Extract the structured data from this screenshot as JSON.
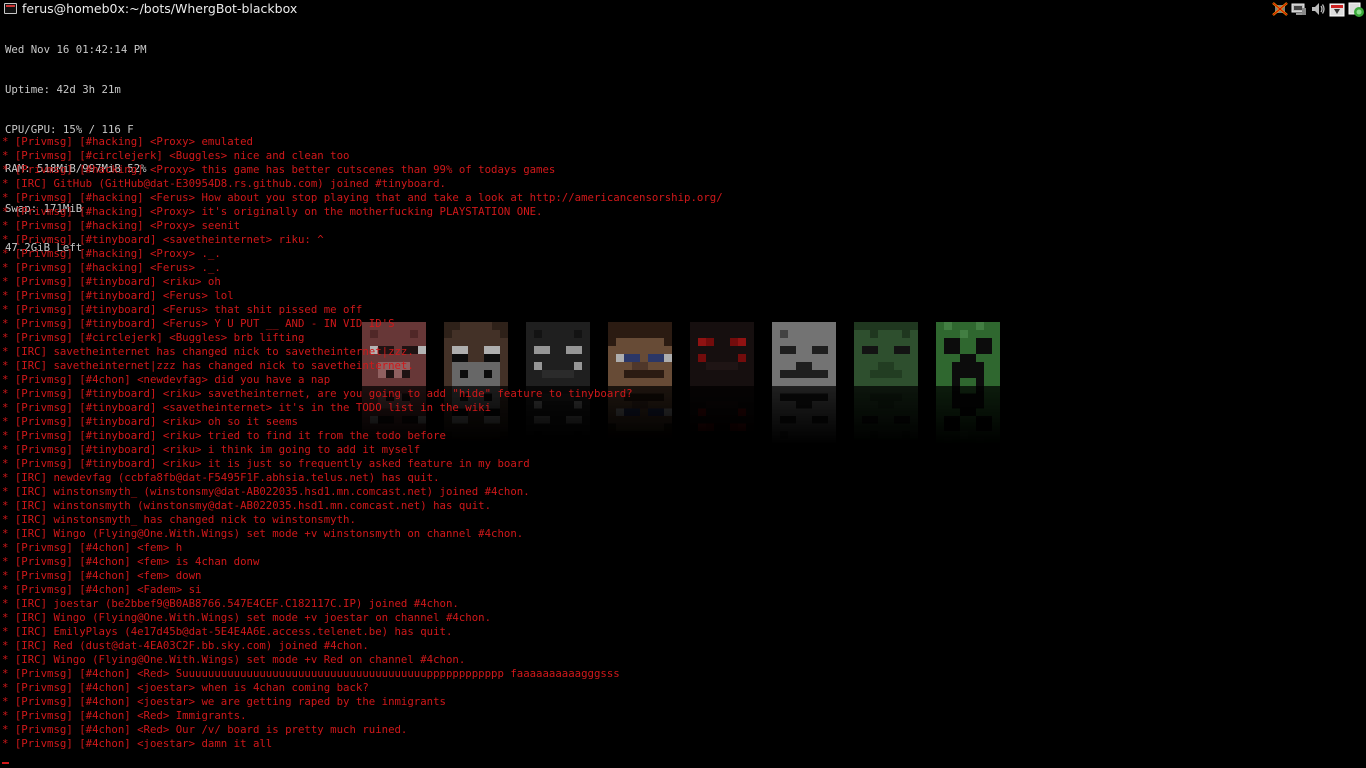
{
  "window": {
    "title": "ferus@homeb0x:~/bots/WhergBot-blackbox"
  },
  "tray": {
    "icons": [
      "network-disconnected-icon",
      "display-settings-icon",
      "volume-icon",
      "download-icon",
      "update-notifier-icon"
    ]
  },
  "sysinfo": {
    "datetime": "Wed Nov 16 01:42:14 PM",
    "uptime": "Uptime: 42d 3h 21m",
    "cpu_gpu": "CPU/GPU: 15% / 116 F",
    "ram": "RAM: 518MiB/997MiB 52%",
    "swap": "Swap: 171MiB",
    "disk": "47.2GiB Left"
  },
  "wallpaper": {
    "mobs": [
      "pig-face",
      "cow-face",
      "spider-face",
      "steve-face",
      "cave-spider-face",
      "skeleton-face",
      "zombie-face",
      "creeper-face"
    ]
  },
  "log": [
    "* [Privmsg] [#hacking] <Proxy> emulated",
    "* [Privmsg] [#circlejerk] <Buggles> nice and clean too",
    "* [Privmsg] [#hacking] <Proxy> this game has better cutscenes than 99% of todays games",
    "* [IRC] GitHub (GitHub@dat-E30954D8.rs.github.com) joined #tinyboard.",
    "* [Privmsg] [#hacking] <Ferus> How about you stop playing that and take a look at http://americancensorship.org/",
    "* [Privmsg] [#hacking] <Proxy> it's originally on the motherfucking PLAYSTATION ONE.",
    "* [Privmsg] [#hacking] <Proxy> seenit",
    "* [Privmsg] [#tinyboard] <savetheinternet> riku: ^",
    "* [Privmsg] [#hacking] <Proxy> ._.",
    "* [Privmsg] [#hacking] <Ferus> ._.",
    "* [Privmsg] [#tinyboard] <riku> oh",
    "* [Privmsg] [#tinyboard] <Ferus> lol",
    "* [Privmsg] [#tinyboard] <Ferus> that shit pissed me off",
    "* [Privmsg] [#tinyboard] <Ferus> Y U PUT __ AND - IN VID ID'S",
    "* [Privmsg] [#circlejerk] <Buggles> brb lifting",
    "* [IRC] savetheinternet has changed nick to savetheinternet|zzz.",
    "* [IRC] savetheinternet|zzz has changed nick to savetheinternet.",
    "* [Privmsg] [#4chon] <newdevfag> did you have a nap",
    "* [Privmsg] [#tinyboard] <riku> savetheinternet, are you going to add \"hide\" feature to tinyboard?",
    "* [Privmsg] [#tinyboard] <savetheinternet> it's in the TODO list in the wiki",
    "* [Privmsg] [#tinyboard] <riku> oh so it seems",
    "* [Privmsg] [#tinyboard] <riku> tried to find it from the todo before",
    "* [Privmsg] [#tinyboard] <riku> i think im going to add it myself",
    "* [Privmsg] [#tinyboard] <riku> it is just so frequently asked feature in my board",
    "* [IRC] newdevfag (ccbfa8fb@dat-F5495F1F.abhsia.telus.net) has quit.",
    "* [IRC] winstonsmyth_ (winstonsmy@dat-AB022035.hsd1.mn.comcast.net) joined #4chon.",
    "* [IRC] winstonsmyth (winstonsmy@dat-AB022035.hsd1.mn.comcast.net) has quit.",
    "* [IRC] winstonsmyth_ has changed nick to winstonsmyth.",
    "* [IRC] Wingo (Flying@One.With.Wings) set mode +v winstonsmyth on channel #4chon.",
    "* [Privmsg] [#4chon] <fem> h",
    "* [Privmsg] [#4chon] <fem> is 4chan donw",
    "* [Privmsg] [#4chon] <fem> down",
    "* [Privmsg] [#4chon] <Fadem> si",
    "* [IRC] joestar (be2bbef9@B0AB8766.547E4CEF.C182117C.IP) joined #4chon.",
    "* [IRC] Wingo (Flying@One.With.Wings) set mode +v joestar on channel #4chon.",
    "* [IRC] EmilyPlays (4e17d45b@dat-5E4E4A6E.access.telenet.be) has quit.",
    "* [IRC] Red (dust@dat-4EA03C2F.bb.sky.com) joined #4chon.",
    "* [IRC] Wingo (Flying@One.With.Wings) set mode +v Red on channel #4chon.",
    "* [Privmsg] [#4chon] <Red> Suuuuuuuuuuuuuuuuuuuuuuuuuuuuuuuuuuuuuupppppppppppp faaaaaaaaaagggsss",
    "* [Privmsg] [#4chon] <joestar> when is 4chan coming back?",
    "* [Privmsg] [#4chon] <joestar> we are getting raped by the inmigrants",
    "* [Privmsg] [#4chon] <Red> Immigrants.",
    "* [Privmsg] [#4chon] <Red> Our /v/ board is pretty much ruined.",
    "* [Privmsg] [#4chon] <joestar> damn it all"
  ],
  "colors": {
    "log_text": "#d0181a",
    "sysinfo_text": "#c9c9c9",
    "background": "#000000"
  }
}
